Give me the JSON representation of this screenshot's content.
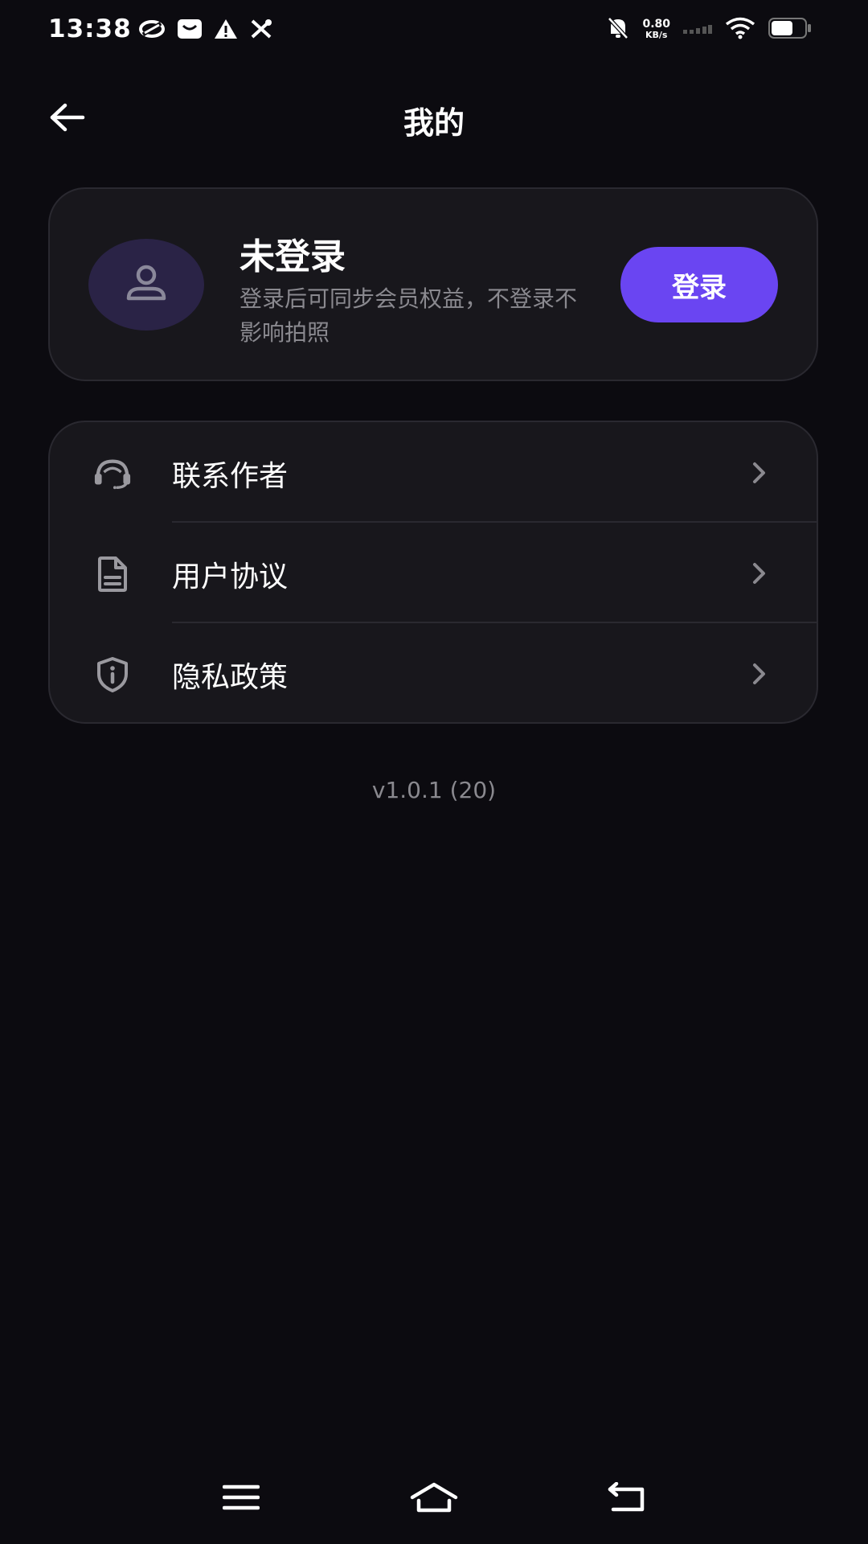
{
  "status_bar": {
    "time": "13:38",
    "net_speed_value": "0.80",
    "net_speed_unit": "KB/s",
    "left_icons": [
      "link-icon",
      "mail-icon",
      "warning-icon",
      "tools-icon"
    ],
    "right_icons": [
      "bell-off-icon",
      "signal-icon",
      "wifi-icon",
      "battery-icon"
    ]
  },
  "header": {
    "title": "我的",
    "back_icon": "arrow-left-icon"
  },
  "profile": {
    "name": "未登录",
    "hint": "登录后可同步会员权益，不登录不影响拍照",
    "login_label": "登录",
    "avatar_icon": "person-icon"
  },
  "menu": {
    "items": [
      {
        "label": "联系作者",
        "icon": "headset-icon"
      },
      {
        "label": "用户协议",
        "icon": "document-icon"
      },
      {
        "label": "隐私政策",
        "icon": "shield-info-icon"
      }
    ]
  },
  "version": "v1.0.1 (20)",
  "nav_bar": {
    "icons": [
      "menu-icon",
      "home-icon",
      "back-icon"
    ]
  },
  "colors": {
    "background": "#0c0b10",
    "card": "#18171c",
    "accent": "#6a45f2",
    "avatar_bg": "#2a2346",
    "muted_text": "#8a898f"
  }
}
